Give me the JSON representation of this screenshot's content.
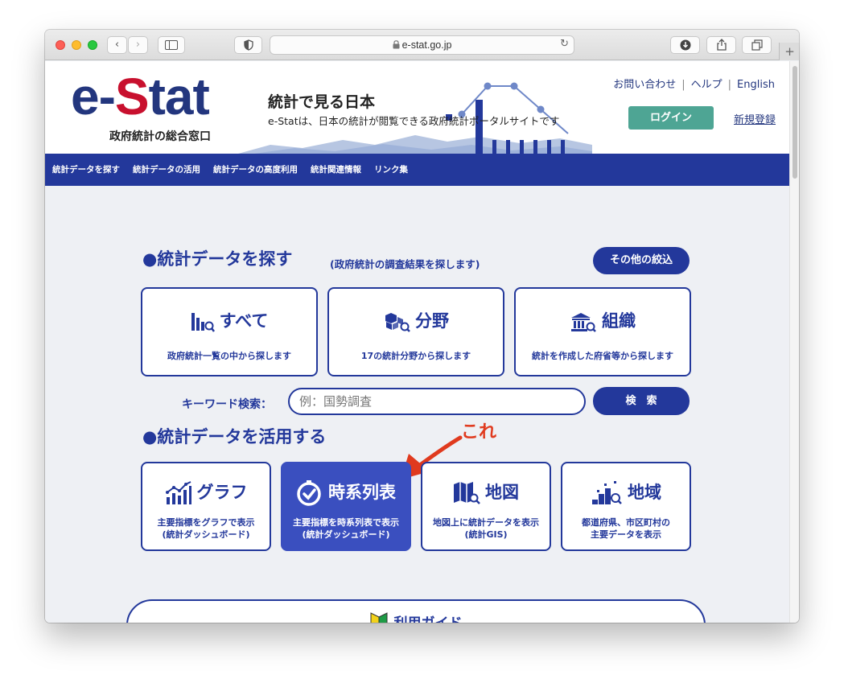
{
  "browser": {
    "url": "e-stat.go.jp",
    "lock_icon": "lock-icon",
    "reload_icon": "reload-icon"
  },
  "header": {
    "logo_prefix": "e-",
    "logo_s": "S",
    "logo_suffix": "tat",
    "logo_subtitle": "政府統計の総合窓口",
    "site_title": "統計で見る日本",
    "site_description": "e-Statは、日本の統計が閲覧できる政府統計ポータルサイトです",
    "links": [
      "お問い合わせ",
      "ヘルプ",
      "English"
    ],
    "link_separator": "|",
    "login": "ログイン",
    "register": "新規登録",
    "colors": {
      "brand": "#23389b",
      "logo_red": "#c8102e",
      "login": "#4ea594"
    }
  },
  "nav": {
    "items": [
      "統計データを探す",
      "統計データの活用",
      "統計データの高度利用",
      "統計関連情報",
      "リンク集"
    ]
  },
  "search_section": {
    "title": "●統計データを探す",
    "subtitle": "(政府統計の調査結果を探します)",
    "other_filters": "その他の絞込",
    "cards": [
      {
        "title": "すべて",
        "desc": "政府統計一覧の中から探します",
        "icon": "bar-chart-search-icon"
      },
      {
        "title": "分野",
        "desc": "17の統計分野から探します",
        "icon": "cubes-search-icon"
      },
      {
        "title": "組織",
        "desc": "統計を作成した府省等から探します",
        "icon": "building-search-icon"
      }
    ],
    "keyword_label": "キーワード検索：",
    "keyword_placeholder": "例：国勢調査",
    "search_button": "検　索"
  },
  "use_section": {
    "title": "●統計データを活用する",
    "cards": [
      {
        "title": "グラフ",
        "desc1": "主要指標をグラフで表示",
        "desc2": "(統計ダッシュボード)",
        "icon": "graph-icon"
      },
      {
        "title": "時系列表",
        "desc1": "主要指標を時系列表で表示",
        "desc2": "(統計ダッシュボード)",
        "icon": "clock-check-icon"
      },
      {
        "title": "地図",
        "desc1": "地図上に統計データを表示",
        "desc2": "(統計GIS)",
        "icon": "map-search-icon"
      },
      {
        "title": "地域",
        "desc1": "都道府県、市区町村の",
        "desc2": "主要データを表示",
        "icon": "region-stairs-icon"
      }
    ]
  },
  "annotation": {
    "text": "これ",
    "color": "#e03a1e"
  },
  "guide": {
    "label": "利用ガイド",
    "icon": "beginner-mark-icon"
  }
}
